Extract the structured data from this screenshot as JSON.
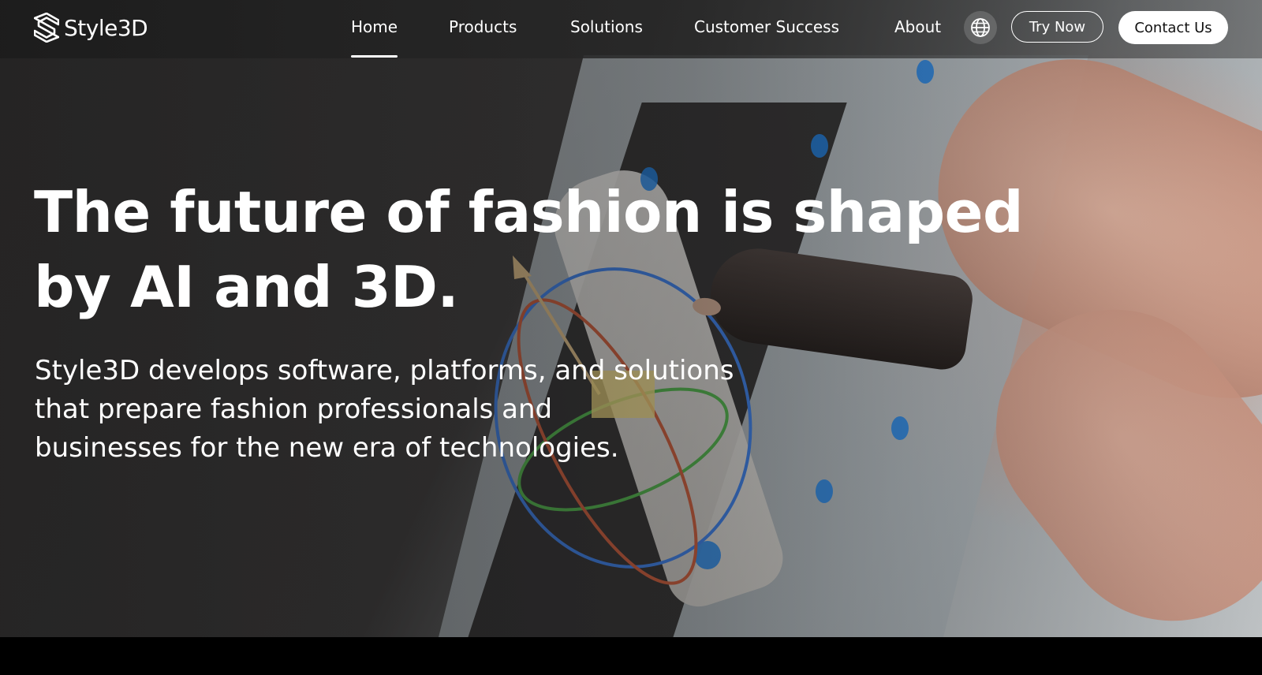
{
  "brand": {
    "name": "Style3D",
    "logo_icon": "style3d-s-logo-icon"
  },
  "nav": {
    "items": [
      {
        "label": "Home",
        "active": true
      },
      {
        "label": "Products",
        "active": false
      },
      {
        "label": "Solutions",
        "active": false
      },
      {
        "label": "Customer Success",
        "active": false
      },
      {
        "label": "About",
        "active": false
      }
    ],
    "language_icon": "globe-icon",
    "try_now_label": "Try Now",
    "contact_label": "Contact Us"
  },
  "hero": {
    "headline_line1": "The future of fashion is shaped",
    "headline_line2": "by AI and 3D.",
    "sub_line1": "Style3D develops software, platforms, and solutions",
    "sub_line2": "that prepare fashion professionals and",
    "sub_line3": "businesses for the new era of technologies."
  },
  "colors": {
    "nav_background": "#1c1c1c",
    "text": "#ffffff",
    "cta_background": "#ffffff",
    "cta_text": "#111111",
    "page_bottom": "#000000"
  }
}
